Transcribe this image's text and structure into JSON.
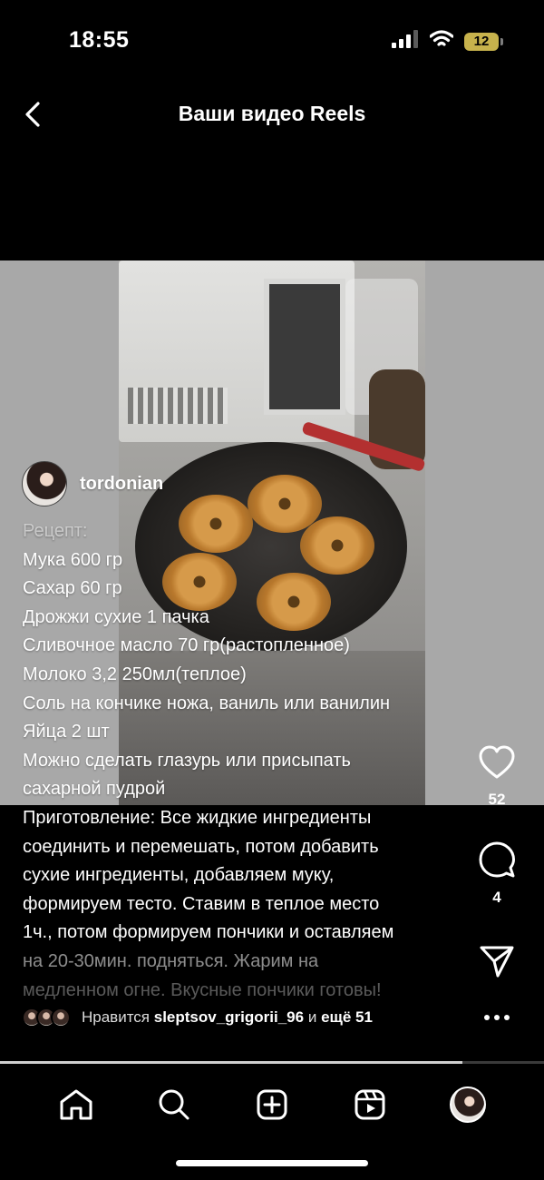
{
  "status_bar": {
    "time": "18:55",
    "battery": "12"
  },
  "header": {
    "title": "Ваши видео Reels"
  },
  "post": {
    "author": "tordonian",
    "caption_lines": [
      "Рецепт:",
      "Мука 600 гр",
      "Сахар 60 гр",
      "Дрожжи сухие 1 пачка",
      "Сливочное масло 70 гр(растопленное)",
      "Молоко 3,2 250мл(теплое)",
      "Соль на кончике ножа, ваниль или ванилин",
      "Яйца 2 шт",
      "Можно сделать глазурь или присыпать",
      "сахарной пудрой",
      "Приготовление: Все жидкие ингредиенты",
      "соединить и перемешать, потом добавить",
      "сухие ингредиенты, добавляем муку,",
      "формируем тесто. Ставим в теплое место",
      "1ч., потом формируем пончики и оставляем",
      "на 20-30мин. подняться. Жарим на",
      "медленном огне. Вкусные пончики готовы!"
    ],
    "likes_count": "52",
    "comments_count": "4",
    "liked_by_prefix": "Нравится",
    "liked_by_user": "sleptsov_grigorii_96",
    "liked_by_and": "и",
    "liked_by_rest": "ещё 51",
    "progress": 0.85
  },
  "icons": {
    "back": "chevron-left-icon",
    "like": "heart-icon",
    "comment": "comment-icon",
    "share": "send-icon",
    "more": "more-icon",
    "nav": [
      "home-icon",
      "search-icon",
      "create-icon",
      "reels-icon",
      "profile-avatar"
    ]
  }
}
